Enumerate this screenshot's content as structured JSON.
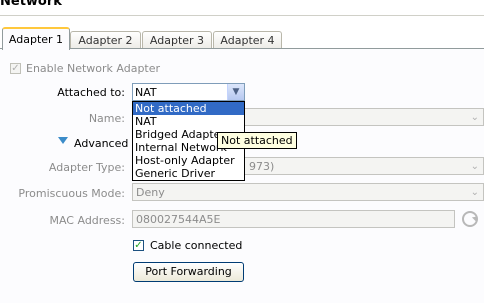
{
  "window": {
    "title": "Network"
  },
  "tabs": [
    "Adapter 1",
    "Adapter 2",
    "Adapter 3",
    "Adapter 4"
  ],
  "enable_adapter": {
    "label": "Enable Network Adapter",
    "checked": true
  },
  "attached_to": {
    "label": "Attached to:",
    "value": "NAT",
    "options": [
      "Not attached",
      "NAT",
      "Bridged Adapter",
      "Internal Network",
      "Host-only Adapter",
      "Generic Driver"
    ],
    "highlighted": "Not attached",
    "tooltip": "Not attached"
  },
  "name": {
    "label": "Name:"
  },
  "advanced": {
    "label": "Advanced"
  },
  "adapter_type": {
    "label": "Adapter Type:",
    "value_suffix": "973)"
  },
  "promiscuous": {
    "label": "Promiscuous Mode:",
    "value": "Deny"
  },
  "mac": {
    "label": "MAC Address:",
    "value": "080027544A5E"
  },
  "cable": {
    "label": "Cable connected",
    "checked": true
  },
  "port_forwarding": {
    "label": "Port Forwarding"
  },
  "colors": {
    "selection": "#316ac5",
    "tab_accent": "#ffc83c",
    "tooltip_bg": "#ffffe1"
  }
}
